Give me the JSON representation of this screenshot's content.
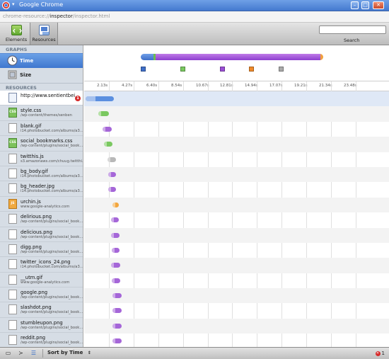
{
  "window": {
    "title": "Google Chrome",
    "url_prefix": "chrome-resource://",
    "url_bold": "inspector",
    "url_suffix": "/inspector.html"
  },
  "toolbar": {
    "elements_label": "Elements",
    "resources_label": "Resources",
    "search_label": "Search",
    "search_value": ""
  },
  "sidebar": {
    "graphs_header": "GRAPHS",
    "graphs": [
      {
        "label": "Time",
        "icon": "clock-icon",
        "selected": true
      },
      {
        "label": "Size",
        "icon": "size-icon",
        "selected": false
      }
    ],
    "resources_header": "RESOURCES",
    "resources": [
      {
        "name": "http://www.sentientbei...",
        "path": "",
        "type": "doc",
        "errors": "1"
      },
      {
        "name": "style.css",
        "path": "/wp-content/themes/senben",
        "type": "css"
      },
      {
        "name": "blank.gif",
        "path": "i14.photobucket.com/albums/a3...",
        "type": "img"
      },
      {
        "name": "social_bookmarks.css",
        "path": "/wp-content/plugins/social_book...",
        "type": "css"
      },
      {
        "name": "twitthis.js",
        "path": "s3.amazonaws.com/chuug.twitthi...",
        "type": "img"
      },
      {
        "name": "bg_body.gif",
        "path": "i14.photobucket.com/albums/a3...",
        "type": "img"
      },
      {
        "name": "bg_header.jpg",
        "path": "i14.photobucket.com/albums/a3...",
        "type": "img"
      },
      {
        "name": "urchin.js",
        "path": "www.google-analytics.com",
        "type": "js"
      },
      {
        "name": "delirious.png",
        "path": "/wp-content/plugins/social_book...",
        "type": "img"
      },
      {
        "name": "delicious.png",
        "path": "/wp-content/plugins/social_book...",
        "type": "img"
      },
      {
        "name": "digg.png",
        "path": "/wp-content/plugins/social_book...",
        "type": "img"
      },
      {
        "name": "twitter_icons_24.png",
        "path": "i14.photobucket.com/albums/a3...",
        "type": "img"
      },
      {
        "name": "__utm.gif",
        "path": "www.google-analytics.com",
        "type": "img"
      },
      {
        "name": "google.png",
        "path": "/wp-content/plugins/social_book...",
        "type": "img"
      },
      {
        "name": "slashdot.png",
        "path": "/wp-content/plugins/social_book...",
        "type": "img"
      },
      {
        "name": "stumbleupon.png",
        "path": "/wp-content/plugins/social_book...",
        "type": "img"
      },
      {
        "name": "reddit.png",
        "path": "/wp-content/plugins/social_book...",
        "type": "img"
      }
    ]
  },
  "timeline": {
    "ticks": [
      "2.13s",
      "4.27s",
      "6.40s",
      "8.54s",
      "10.67s",
      "12.81s",
      "14.94s",
      "17.07s",
      "19.21s",
      "21.34s",
      "23.48s"
    ],
    "colors": {
      "document": "#5b8fe0",
      "stylesheet": "#7ac860",
      "image": "#a566d8",
      "script": "#f2a63e",
      "other": "#b8b8b8"
    }
  },
  "statusbar": {
    "sort_label": "Sort by Time",
    "error_count": "1"
  }
}
